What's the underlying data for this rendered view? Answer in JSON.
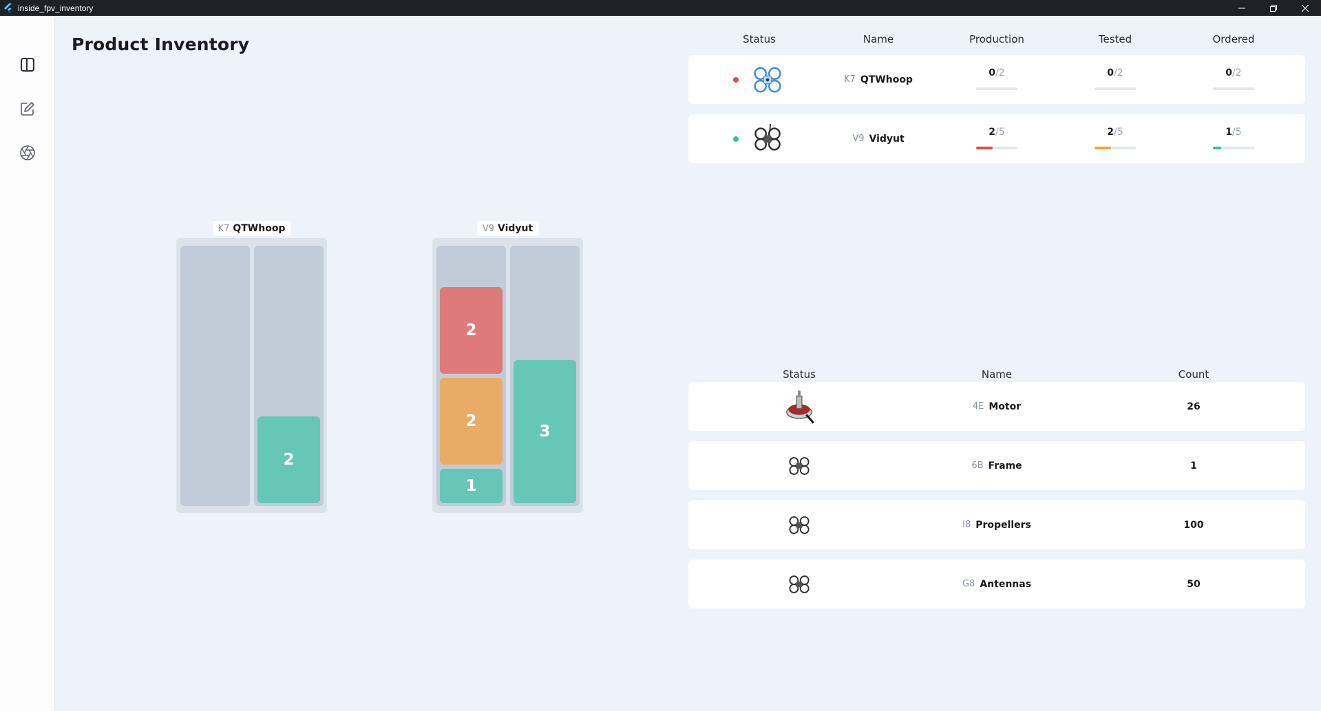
{
  "window": {
    "title": "inside_fpv_inventory"
  },
  "page": {
    "title": "Product Inventory"
  },
  "nav": [
    {
      "name": "dashboard-icon"
    },
    {
      "name": "edit-icon"
    },
    {
      "name": "aperture-icon"
    }
  ],
  "groups": [
    {
      "code": "K7",
      "name": "QTWhoop",
      "columns": [
        {
          "segments": []
        },
        {
          "segments": [
            {
              "value": "2",
              "color": "#67c7b6"
            }
          ]
        }
      ]
    },
    {
      "code": "V9",
      "name": "Vidyut",
      "columns": [
        {
          "segments": [
            {
              "value": "2",
              "color": "#de7a7a"
            },
            {
              "value": "2",
              "color": "#e9ac66"
            },
            {
              "value": "1",
              "color": "#67c7b6"
            }
          ]
        },
        {
          "segments": [
            {
              "value": "3",
              "color": "#67c7b6"
            }
          ]
        }
      ]
    }
  ],
  "products_table": {
    "headers": [
      "Status",
      "Name",
      "Production",
      "Tested",
      "Ordered"
    ],
    "rows": [
      {
        "status_color": "#e24b4b",
        "image": "blue-drone-icon",
        "code": "K7",
        "name": "QTWhoop",
        "production": {
          "num": "0",
          "den": "2",
          "fraction": 0
        },
        "tested": {
          "num": "0",
          "den": "2",
          "fraction": 0
        },
        "ordered": {
          "num": "0",
          "den": "2",
          "fraction": 0
        }
      },
      {
        "status_color": "#2cc39d",
        "image": "black-drone-icon",
        "code": "V9",
        "name": "Vidyut",
        "production": {
          "num": "2",
          "den": "5",
          "fraction": 0.4
        },
        "tested": {
          "num": "2",
          "den": "5",
          "fraction": 0.4
        },
        "ordered": {
          "num": "1",
          "den": "5",
          "fraction": 0.2
        }
      }
    ],
    "bar_colors": {
      "production": "#e24b4b",
      "tested": "#f0a43a",
      "ordered": "#2cc39d"
    }
  },
  "parts_table": {
    "headers": [
      "Status",
      "Name",
      "Count"
    ],
    "rows": [
      {
        "image": "motor-icon",
        "code": "4E",
        "name": "Motor",
        "count": "26"
      },
      {
        "image": "drone-frame-icon",
        "code": "6B",
        "name": "Frame",
        "count": "1"
      },
      {
        "image": "drone-frame-icon",
        "code": "I8",
        "name": "Propellers",
        "count": "100"
      },
      {
        "image": "drone-frame-icon",
        "code": "G8",
        "name": "Antennas",
        "count": "50"
      }
    ]
  }
}
